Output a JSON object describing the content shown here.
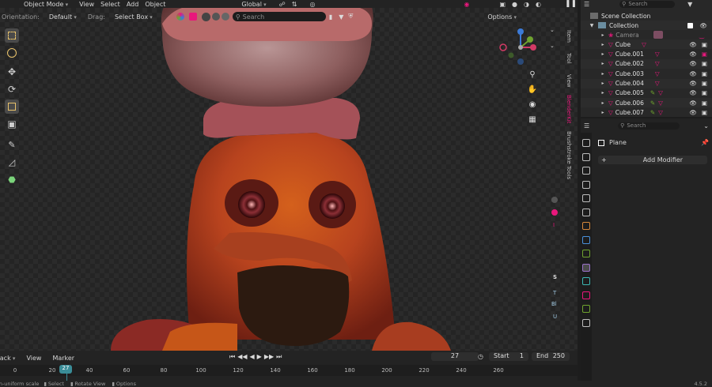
{
  "header": {
    "mode": "Object Mode",
    "menus": [
      "View",
      "Select",
      "Add",
      "Object"
    ],
    "transform_orientation": "Global",
    "orientation_label": "Orientation:",
    "orientation_value": "Default",
    "drag_label": "Drag:",
    "drag_value": "Select Box",
    "options": "Options",
    "search_placeholder": "Search"
  },
  "n_panel_tabs": [
    "Item",
    "Tool",
    "View",
    "BlenderKit",
    "Brushstroke Tools"
  ],
  "n_panel_letters": [
    "I",
    "S",
    "T",
    "Bl",
    "U"
  ],
  "outliner": {
    "search_placeholder": "Search",
    "root": "Scene Collection",
    "collection": "Collection",
    "items": [
      "Camera",
      "Cube",
      "Cube.001",
      "Cube.002",
      "Cube.003",
      "Cube.004",
      "Cube.005",
      "Cube.006",
      "Cube.007"
    ]
  },
  "properties": {
    "search_placeholder": "Search",
    "object_name": "Plane",
    "add_modifier": "Add Modifier"
  },
  "timeline": {
    "menus": [
      "Playback",
      "View",
      "Marker"
    ],
    "current_frame": "27",
    "start_label": "Start",
    "start_value": "1",
    "end_label": "End",
    "end_value": "250",
    "ticks": [
      "0",
      "20",
      "40",
      "60",
      "80",
      "100",
      "120",
      "140",
      "160",
      "180",
      "200",
      "220",
      "240",
      "260"
    ]
  },
  "status": {
    "items": [
      "Non-uniform scale",
      "Select",
      "Rotate View",
      "Options"
    ],
    "version": "4.5.2"
  },
  "colors": {
    "accent": "#e9177c",
    "axis_x": "#d23a65",
    "axis_y": "#6fa32f",
    "axis_z": "#3c7bd8",
    "selected_frame": "#3a8d98"
  }
}
